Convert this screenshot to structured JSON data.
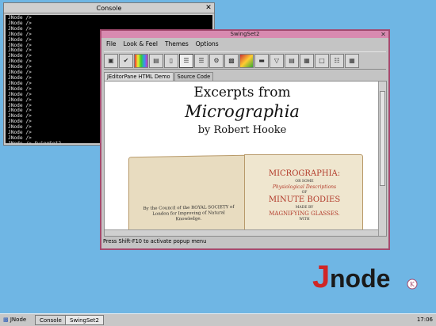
{
  "console": {
    "title": "Console",
    "lines": "JNode />\nJNode />\nJNode />\nJNode />\nJNode />\nJNode />\nJNode />\nJNode />\nJNode />\nJNode />\nJNode />\nJNode />\nJNode />\nJNode />\nJNode />\nJNode />\nJNode />\nJNode />\nJNode />\nJNode />\nJNode />\nJNode />\nJNode />\nJNode /> SwingSet2\nJNode />\nJNode /> _"
  },
  "swingset": {
    "title": "SwingSet2",
    "menus": [
      "File",
      "Look & Feel",
      "Themes",
      "Options"
    ],
    "tabs": [
      "JEditorPane HTML Demo",
      "Source Code"
    ],
    "heading1": "Excerpts from",
    "heading2": "Micrographia",
    "heading3": "by Robert Hooke",
    "book": {
      "right_title": "MICROGRAPHIA:",
      "right_sub": "OR SOME",
      "right_sub2": "Physiological Descriptions",
      "right_of": "OF",
      "right_big": "MINUTE BODIES",
      "right_made": "MADE BY",
      "right_mag": "MAGNIFYING GLASSES.",
      "right_with": "WITH",
      "left_text": "By the Council of the ROYAL SOCIETY of London for Improving of Natural Knowledge."
    },
    "status": "Press Shift-F10 to activate popup menu"
  },
  "logo": {
    "text": "Jnode"
  },
  "taskbar": {
    "start": "JNode",
    "buttons": [
      "Console",
      "SwingSet2"
    ],
    "clock": "17:06"
  }
}
